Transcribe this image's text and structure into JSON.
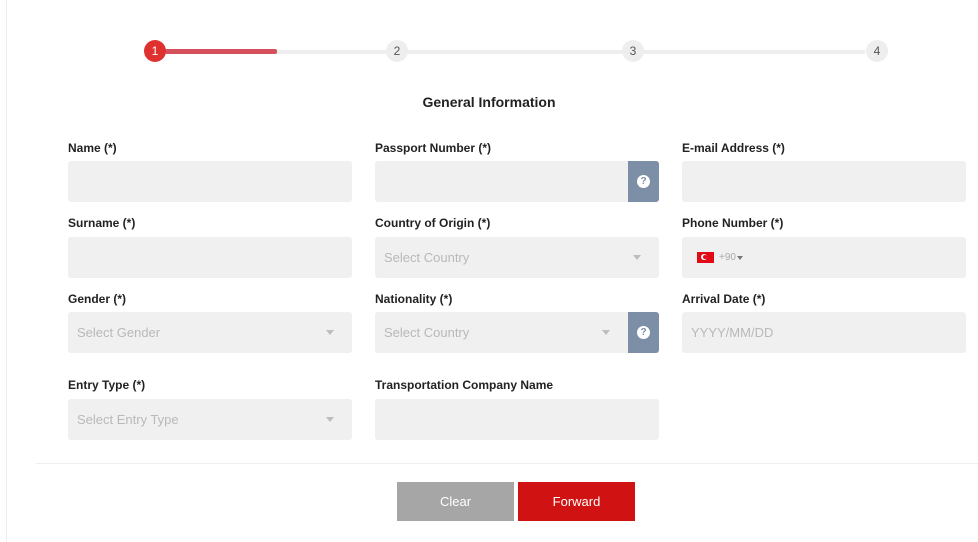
{
  "stepper": {
    "steps": [
      "1",
      "2",
      "3",
      "4"
    ],
    "active_step": 1
  },
  "section_title": "General Information",
  "fields": {
    "name": {
      "label": "Name (*)",
      "value": ""
    },
    "passport": {
      "label": "Passport Number (*)",
      "value": "",
      "help": "?"
    },
    "email": {
      "label": "E-mail Address (*)",
      "value": ""
    },
    "surname": {
      "label": "Surname (*)",
      "value": ""
    },
    "country_origin": {
      "label": "Country of Origin (*)",
      "placeholder": "Select Country"
    },
    "phone": {
      "label": "Phone Number (*)",
      "dial_code": "+90"
    },
    "gender": {
      "label": "Gender (*)",
      "placeholder": "Select Gender"
    },
    "nationality": {
      "label": "Nationality (*)",
      "placeholder": "Select Country",
      "help": "?"
    },
    "arrival_date": {
      "label": "Arrival Date (*)",
      "placeholder": "YYYY/MM/DD"
    },
    "entry_type": {
      "label": "Entry Type (*)",
      "placeholder": "Select Entry Type"
    },
    "transport_company": {
      "label": "Transportation Company Name",
      "value": ""
    }
  },
  "buttons": {
    "clear": "Clear",
    "forward": "Forward"
  },
  "colors": {
    "accent": "#d11212",
    "step_active": "#e03131",
    "progress": "#d4505d",
    "help_button": "#7d8fa6"
  },
  "icons": {
    "help": "question-circle-icon",
    "dropdown": "chevron-down-icon",
    "flag": "turkey-flag-icon"
  }
}
